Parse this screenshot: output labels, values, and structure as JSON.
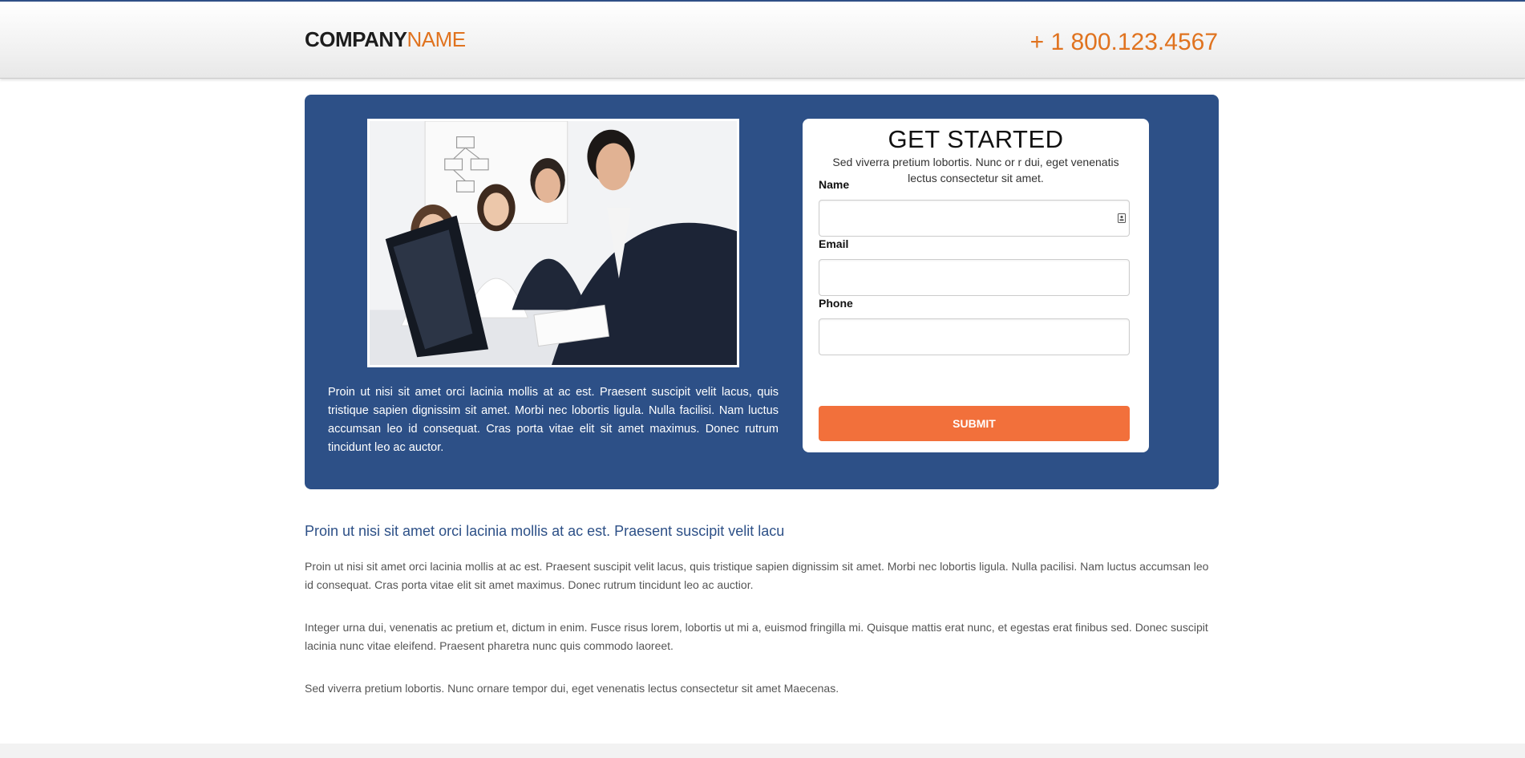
{
  "header": {
    "logo_bold": "COMPANY",
    "logo_light": "NAME",
    "phone": "+ 1 800.123.4567"
  },
  "hero": {
    "image_alt": "business-team-meeting-photo",
    "text": "Proin ut nisi sit amet orci lacinia mollis at ac est. Praesent suscipit velit lacus, quis tristique sapien dignissim sit amet. Morbi nec lobortis ligula. Nulla facilisi. Nam luctus accumsan leo id consequat. Cras porta vitae elit sit amet maximus. Donec rutrum tincidunt leo ac auctor."
  },
  "form": {
    "title": "GET STARTED",
    "subtitle": "Sed viverra pretium lobortis. Nunc or r dui, eget venenatis lectus consectetur sit amet.",
    "fields": [
      {
        "label": "Name",
        "value": "",
        "placeholder": ""
      },
      {
        "label": "Email",
        "value": "",
        "placeholder": ""
      },
      {
        "label": "Phone",
        "value": "",
        "placeholder": ""
      }
    ],
    "submit_label": "SUBMIT"
  },
  "content": {
    "heading": "Proin ut nisi sit amet orci lacinia mollis at ac est. Praesent suscipit velit lacu",
    "paragraphs": [
      "Proin ut nisi sit amet orci lacinia mollis at ac est. Praesent suscipit velit lacus, quis tristique sapien dignissim sit amet. Morbi nec lobortis ligula. Nulla pacilisi. Nam luctus accumsan leo id consequat. Cras porta vitae elit sit amet maximus. Donec rutrum tincidunt leo ac auctior.",
      "Integer urna dui, venenatis ac pretium et, dictum in enim. Fusce risus lorem, lobortis ut mi a, euismod fringilla mi. Quisque mattis erat nunc, et egestas erat finibus sed. Donec suscipit lacinia nunc vitae eleifend. Praesent pharetra nunc quis commodo laoreet.",
      "Sed viverra pretium lobortis. Nunc ornare tempor dui, eget venenatis lectus consectetur sit amet Maecenas."
    ]
  },
  "colors": {
    "brand_blue": "#2d5087",
    "accent_orange": "#e0731f",
    "button_orange": "#f2703b"
  },
  "icons": {
    "autofill": "contact-card-icon"
  }
}
